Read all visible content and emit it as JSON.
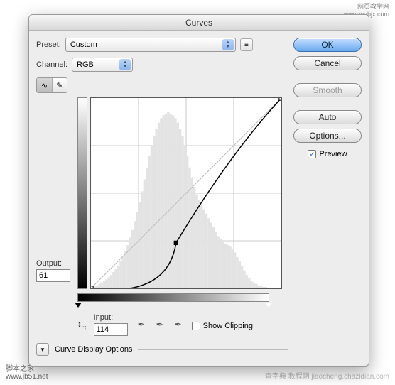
{
  "title": "Curves",
  "preset": {
    "label": "Preset:",
    "value": "Custom"
  },
  "channel": {
    "label": "Channel:",
    "value": "RGB"
  },
  "output": {
    "label": "Output:",
    "value": "61"
  },
  "input": {
    "label": "Input:",
    "value": "114"
  },
  "show_clipping": {
    "label": "Show Clipping",
    "checked": false
  },
  "disclosure": {
    "label": "Curve Display Options"
  },
  "buttons": {
    "ok": "OK",
    "cancel": "Cancel",
    "smooth": "Smooth",
    "auto": "Auto",
    "options": "Options..."
  },
  "preview": {
    "label": "Preview",
    "checked": true
  },
  "watermarks": {
    "top_right_line1": "网页教学网",
    "top_right_line2": "www.webjx.com",
    "bottom_left_line1": "脚本之家",
    "bottom_left_line2": "www.jb51.net",
    "bottom_right_line1": "查字典 教程网",
    "bottom_right_line2": "jiaocheng.chazidian.com"
  },
  "chart_data": {
    "type": "line",
    "title": "Curves",
    "xlabel": "Input",
    "ylabel": "Output",
    "xlim": [
      0,
      255
    ],
    "ylim": [
      0,
      255
    ],
    "points": [
      {
        "x": 0,
        "y": 0
      },
      {
        "x": 114,
        "y": 61
      },
      {
        "x": 255,
        "y": 255
      }
    ],
    "histogram": [
      2,
      3,
      4,
      6,
      8,
      10,
      12,
      15,
      18,
      22,
      26,
      30,
      36,
      42,
      50,
      58,
      68,
      78,
      90,
      102,
      116,
      130,
      146,
      162,
      178,
      192,
      204,
      214,
      222,
      228,
      232,
      234,
      236,
      234,
      232,
      228,
      222,
      214,
      204,
      192,
      178,
      162,
      148,
      136,
      126,
      118,
      112,
      106,
      100,
      94,
      88,
      82,
      76,
      70,
      66,
      62,
      60,
      58,
      56,
      52,
      48,
      42,
      36,
      30,
      24,
      18,
      14,
      10,
      8,
      6,
      4,
      3,
      2,
      2,
      1,
      1,
      1,
      1,
      0,
      0
    ]
  }
}
